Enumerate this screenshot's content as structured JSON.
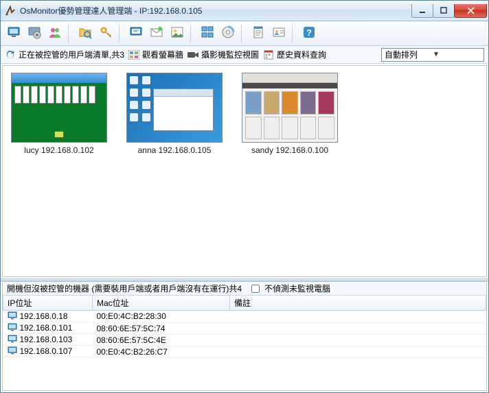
{
  "window": {
    "title": "OsMonitor優勢管理達人管理端 - IP:192.168.0.105"
  },
  "toolbar": {
    "buttons": [
      {
        "name": "monitor-icon"
      },
      {
        "name": "settings-icon"
      },
      {
        "name": "users-icon"
      },
      {
        "name": "sep"
      },
      {
        "name": "folder-search-icon"
      },
      {
        "name": "key-icon"
      },
      {
        "name": "sep"
      },
      {
        "name": "screen-icon"
      },
      {
        "name": "mail-icon"
      },
      {
        "name": "picture-icon"
      },
      {
        "name": "sep"
      },
      {
        "name": "screens-grid-icon"
      },
      {
        "name": "disc-icon"
      },
      {
        "name": "sep"
      },
      {
        "name": "doc-icon"
      },
      {
        "name": "user-card-icon"
      },
      {
        "name": "sep"
      },
      {
        "name": "help-icon"
      }
    ]
  },
  "subbar": {
    "clientsLabel": "正在被控管的用戶端清單,共3",
    "wallLabel": "觀看螢幕牆",
    "cameraLabel": "攝影機監控視圖",
    "historyLabel": "歷史資料查詢",
    "sortSelected": "自動排列"
  },
  "thumbs": [
    {
      "caption": "lucy 192.168.0.102",
      "kind": "solitaire"
    },
    {
      "caption": "anna 192.168.0.105",
      "kind": "desktop"
    },
    {
      "caption": "sandy 192.168.0.100",
      "kind": "browser"
    }
  ],
  "bottom": {
    "header": "開機但沒被控管的機器 (需要裝用戶端或者用戶端沒有在運行)共4",
    "checkbox": "不偵測未監視電腦",
    "columns": {
      "ip": "IP位址",
      "mac": "Mac位址",
      "note": "備註"
    },
    "rows": [
      {
        "ip": "192.168.0.18",
        "mac": "00:E0:4C:B2:28:30",
        "note": ""
      },
      {
        "ip": "192.168.0.101",
        "mac": "08:60:6E:57:5C:74",
        "note": ""
      },
      {
        "ip": "192.168.0.103",
        "mac": "08:60:6E:57:5C:4E",
        "note": ""
      },
      {
        "ip": "192.168.0.107",
        "mac": "00:E0:4C:B2:26:C7",
        "note": ""
      }
    ]
  }
}
